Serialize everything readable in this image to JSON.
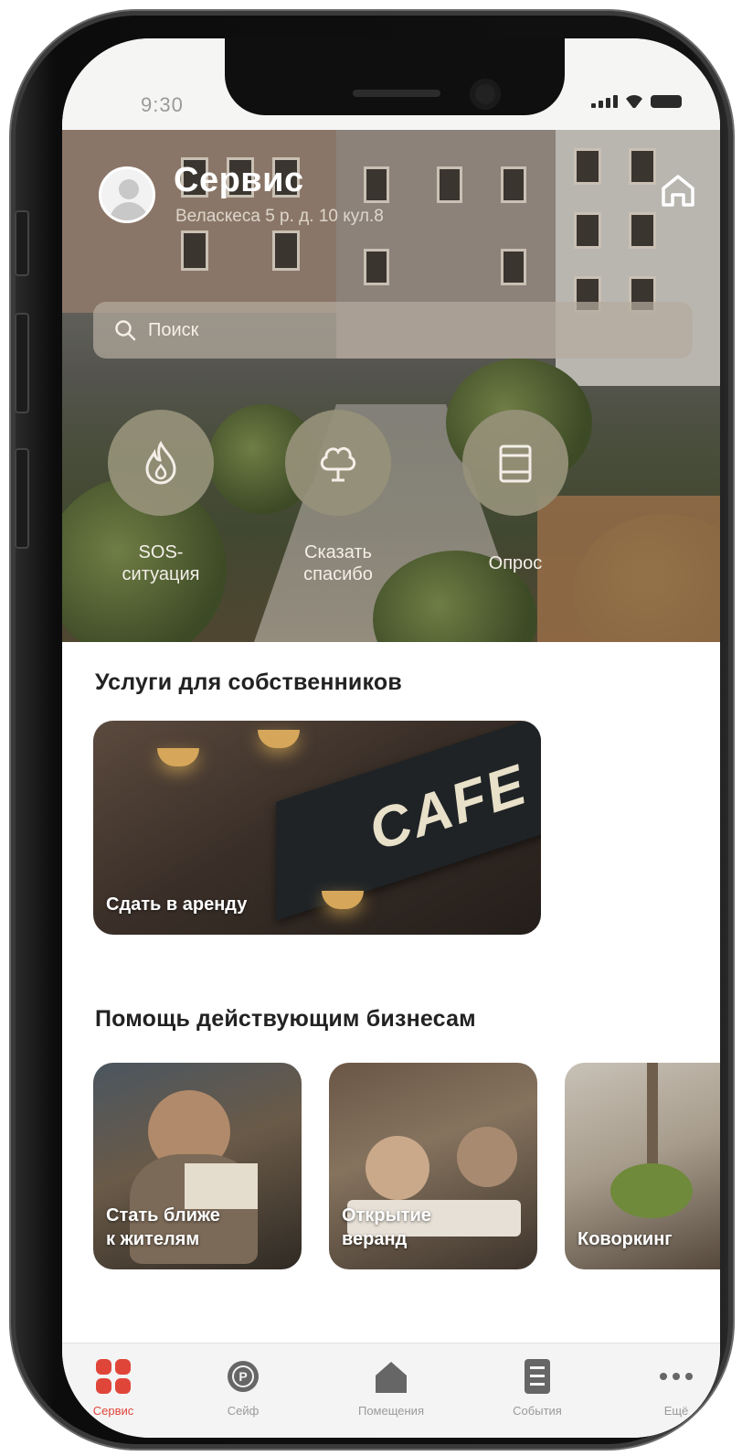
{
  "status_bar": {
    "time": "9:30"
  },
  "header": {
    "title": "Сервис",
    "address": "Веласкеса 5 р. д. 10 кул.8"
  },
  "search": {
    "placeholder": "Поиск"
  },
  "quick_actions": [
    {
      "label_line1": "SOS-",
      "label_line2": "ситуация",
      "icon": "flame-icon"
    },
    {
      "label_line1": "Сказать",
      "label_line2": "спасибо",
      "icon": "tree-icon"
    },
    {
      "label_line1": "Опрос",
      "label_line2": "",
      "icon": "clipboard-icon"
    }
  ],
  "owners_section": {
    "title": "Услуги для собственников",
    "cards": [
      {
        "caption": "Сдать в аренду",
        "sign_text": "CAFE"
      }
    ]
  },
  "business_section": {
    "title": "Помощь действующим бизнесам",
    "cards": [
      {
        "caption_line1": "Стать ближе",
        "caption_line2": "к жителям"
      },
      {
        "caption_line1": "Открытие",
        "caption_line2": "веранд"
      },
      {
        "caption_line1": "Коворкинг",
        "caption_line2": ""
      }
    ]
  },
  "tabbar": {
    "active_color": "#e0453a",
    "items": [
      {
        "label": "Сервис",
        "icon": "grid-icon",
        "active": true
      },
      {
        "label": "Сейф",
        "icon": "parking-icon",
        "active": false
      },
      {
        "label": "Помещения",
        "icon": "house-icon",
        "active": false
      },
      {
        "label": "События",
        "icon": "document-icon",
        "active": false
      },
      {
        "label": "Ещё",
        "icon": "more-icon",
        "active": false
      }
    ]
  }
}
